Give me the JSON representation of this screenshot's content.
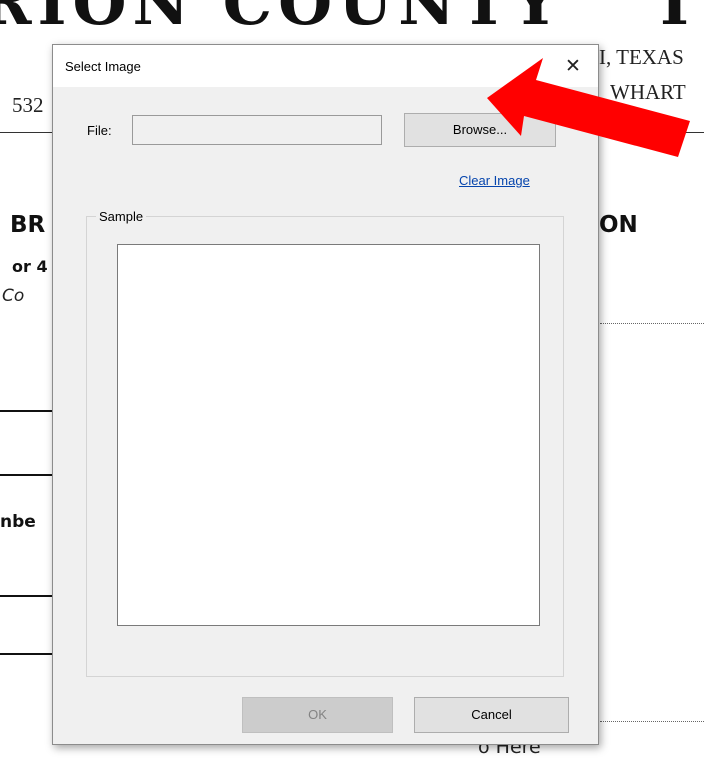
{
  "background_doc": {
    "heading": "RION COUNTY",
    "heading_tail": "I",
    "location_line": "I, TEXAS",
    "left_fragment": "532",
    "address_fragment": "WHART",
    "section_left": "BR",
    "section_right": "ON",
    "line_or4": "or 4",
    "italic_fragment": "Co",
    "member_fragment": "nbe",
    "photo_text": "o Here"
  },
  "dialog": {
    "title": "Select Image",
    "close_glyph": "✕",
    "file_label": "File:",
    "file_value": "",
    "browse_label": "Browse...",
    "clear_image_link": "Clear Image",
    "sample_label": "Sample",
    "ok_label": "OK",
    "cancel_label": "Cancel",
    "ok_enabled": false
  },
  "colors": {
    "dialog_bg": "#f0f0f0",
    "link": "#0645ad",
    "annotation_arrow": "#ff0000"
  }
}
